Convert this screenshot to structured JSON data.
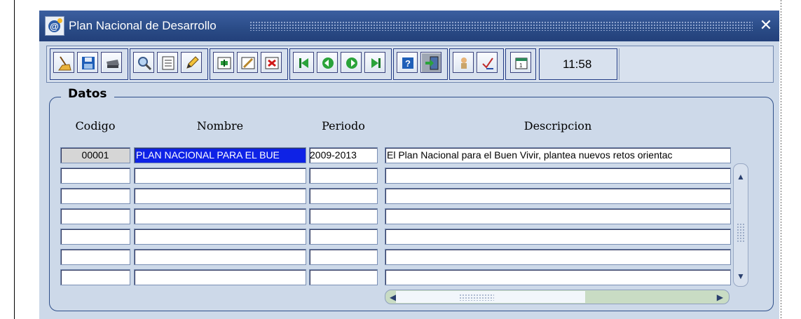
{
  "window": {
    "title": "Plan Nacional de Desarrollo",
    "close_glyph": "✕"
  },
  "toolbar": {
    "groups": [
      [
        {
          "icon": "broom-icon"
        },
        {
          "icon": "save-icon"
        },
        {
          "icon": "printer-icon"
        }
      ],
      [
        {
          "icon": "magnifier-icon"
        },
        {
          "icon": "list-icon"
        },
        {
          "icon": "pencil-icon"
        }
      ],
      [
        {
          "icon": "insert-record-icon"
        },
        {
          "icon": "edit-record-icon"
        },
        {
          "icon": "delete-record-icon"
        }
      ],
      [
        {
          "icon": "first-record-icon"
        },
        {
          "icon": "previous-record-icon"
        },
        {
          "icon": "next-record-icon"
        },
        {
          "icon": "last-record-icon"
        }
      ],
      [
        {
          "icon": "help-icon"
        },
        {
          "icon": "exit-icon"
        }
      ],
      [
        {
          "icon": "person-icon"
        },
        {
          "icon": "check-icon"
        }
      ],
      [
        {
          "icon": "calendar-icon"
        }
      ]
    ],
    "time": "11:58"
  },
  "panel": {
    "label": "Datos",
    "columns": {
      "codigo": "Codigo",
      "nombre": "Nombre",
      "periodo": "Periodo",
      "descripcion": "Descripcion"
    },
    "rows": [
      {
        "codigo": "00001",
        "nombre": "PLAN NACIONAL PARA EL  BUE",
        "periodo": "2009-2013",
        "descripcion": "El Plan Nacional para el Buen Vivir, plantea nuevos retos orientac"
      },
      {
        "codigo": "",
        "nombre": "",
        "periodo": "",
        "descripcion": ""
      },
      {
        "codigo": "",
        "nombre": "",
        "periodo": "",
        "descripcion": ""
      },
      {
        "codigo": "",
        "nombre": "",
        "periodo": "",
        "descripcion": ""
      },
      {
        "codigo": "",
        "nombre": "",
        "periodo": "",
        "descripcion": ""
      },
      {
        "codigo": "",
        "nombre": "",
        "periodo": "",
        "descripcion": ""
      },
      {
        "codigo": "",
        "nombre": "",
        "periodo": "",
        "descripcion": ""
      }
    ]
  },
  "colors": {
    "titlebar": "#2a4b86",
    "window_bg": "#cdd9e9",
    "selection": "#0e22e6",
    "code_cell": "#d6d6d6"
  }
}
